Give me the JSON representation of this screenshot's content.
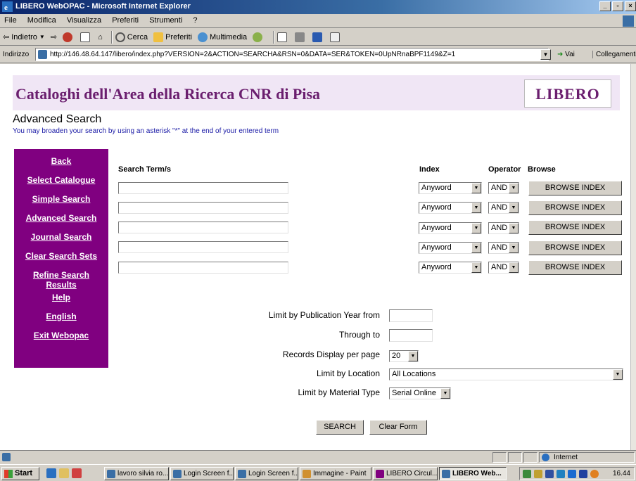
{
  "window": {
    "title": "LIBERO WebOPAC - Microsoft Internet Explorer"
  },
  "menu": [
    "File",
    "Modifica",
    "Visualizza",
    "Preferiti",
    "Strumenti",
    "?"
  ],
  "toolbar": {
    "back": "Indietro",
    "search": "Cerca",
    "favorites": "Preferiti",
    "media": "Multimedia"
  },
  "address": {
    "label": "Indirizzo",
    "url": "http://146.48.64.147/libero/index.php?VERSION=2&ACTION=SEARCHA&RSN=0&DATA=SER&TOKEN=0UpNRnaBPF1149&Z=1",
    "go": "Vai",
    "links": "Collegamenti"
  },
  "page": {
    "heading": "Cataloghi dell'Area della Ricerca CNR di Pisa",
    "logo": "LIBERO",
    "title": "Advanced Search",
    "hint": "You may broaden your search by using an asterisk \"*\" at the end of your entered term"
  },
  "nav": [
    "Back",
    "Select Catalogue",
    "Simple Search",
    "Advanced Search",
    "Journal Search",
    "Clear Search Sets",
    "Refine Search Results",
    "Help",
    "English",
    "Exit Webopac"
  ],
  "form": {
    "col_term": "Search Term/s",
    "col_index": "Index",
    "col_operator": "Operator",
    "col_browse": "Browse",
    "rows": [
      {
        "index": "Anyword",
        "operator": "AND",
        "browse": "BROWSE INDEX"
      },
      {
        "index": "Anyword",
        "operator": "AND",
        "browse": "BROWSE INDEX"
      },
      {
        "index": "Anyword",
        "operator": "AND",
        "browse": "BROWSE INDEX"
      },
      {
        "index": "Anyword",
        "operator": "AND",
        "browse": "BROWSE INDEX"
      },
      {
        "index": "Anyword",
        "operator": "AND",
        "browse": "BROWSE INDEX"
      }
    ],
    "limit_year_from": "Limit by Publication Year from",
    "through_to": "Through to",
    "records_per_page_label": "Records Display per page",
    "records_per_page": "20",
    "location_label": "Limit by Location",
    "location": "All Locations",
    "material_label": "Limit by Material Type",
    "material": "Serial Online",
    "search_btn": "SEARCH",
    "clear_btn": "Clear Form"
  },
  "status": {
    "zone": "Internet"
  },
  "taskbar": {
    "start": "Start",
    "tasks": [
      "lavoro silvia ro...",
      "Login Screen f...",
      "Login Screen f...",
      "Immagine - Paint",
      "LIBERO Circul...",
      "LIBERO Web..."
    ],
    "clock": "16.44"
  }
}
